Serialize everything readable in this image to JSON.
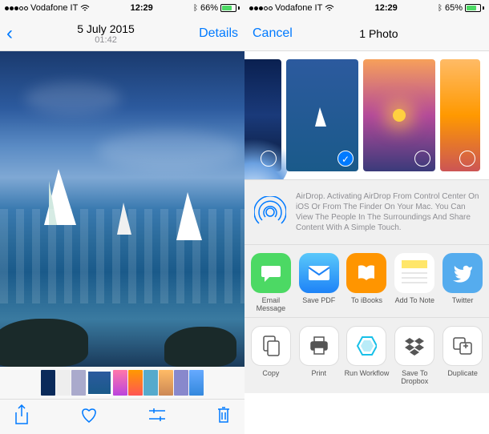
{
  "left": {
    "status": {
      "carrier": "Vodafone IT",
      "time": "12:29",
      "battery_pct": "66%",
      "bluetooth": true
    },
    "nav": {
      "title": "5 July 2015",
      "subtitle": "01:42",
      "details": "Details"
    },
    "toolbar": {
      "share": "Share",
      "favorite": "Favorite",
      "edit": "Edit",
      "delete": "Delete"
    }
  },
  "right": {
    "status": {
      "carrier": "Vodafone IT",
      "time": "12:29",
      "battery_pct": "65%",
      "bluetooth": true
    },
    "nav": {
      "title": "1 Photo",
      "cancel": "Cancel"
    },
    "airdrop": "AirDrop. Activating AirDrop From Control Center On iOS Or From The Finder On Your Mac. You Can View The People In The Surroundings And Share Content With A Simple Touch.",
    "apps": [
      {
        "id": "message",
        "label": "Email Message",
        "bg": "#4cd964"
      },
      {
        "id": "mail",
        "label": "Save PDF",
        "bg": "#1e83f7"
      },
      {
        "id": "ibooks",
        "label": "To iBooks",
        "bg": "#ff9500"
      },
      {
        "id": "notes",
        "label": "Add To Note",
        "bg": "#ffe66a"
      },
      {
        "id": "twitter",
        "label": "Twitter",
        "bg": "#55acee"
      }
    ],
    "actions": [
      {
        "id": "copy",
        "label": "Copy"
      },
      {
        "id": "print",
        "label": "Print"
      },
      {
        "id": "workflow",
        "label": "Run Workflow"
      },
      {
        "id": "dropbox",
        "label": "Save To Dropbox"
      },
      {
        "id": "duplicate",
        "label": "Duplicate"
      }
    ]
  }
}
